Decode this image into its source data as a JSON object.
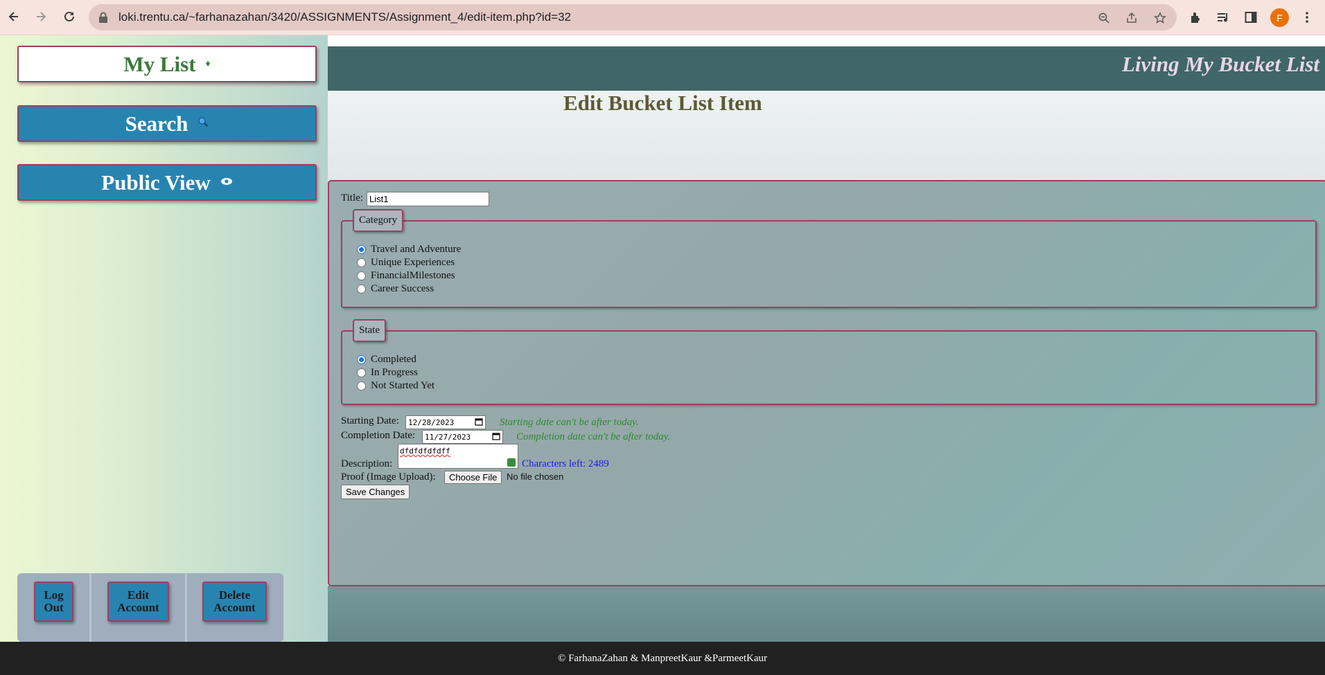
{
  "browser": {
    "url": "loki.trentu.ca/~farhanazahan/3420/ASSIGNMENTS/Assignment_4/edit-item.php?id=32",
    "profile_initial": "F",
    "icons": [
      "back-icon",
      "forward-icon",
      "reload-icon",
      "lock-icon",
      "zoom-icon",
      "share-icon",
      "star-icon",
      "extensions-icon",
      "media-icon",
      "side-panel-icon",
      "menu-icon"
    ]
  },
  "sidebar": {
    "mylist_label": "My List",
    "search_label": "Search",
    "public_label": "Public View",
    "logout_label": "Log Out",
    "edit_account_label": "Edit Account",
    "delete_account_label": "Delete Account"
  },
  "header": {
    "site_title": "Living My Bucket List",
    "page_title": "Edit Bucket List Item"
  },
  "form": {
    "title_label": "Title:",
    "title_value": "List1",
    "category_legend": "Category",
    "categories": [
      {
        "label": "Travel and Adventure",
        "checked": true
      },
      {
        "label": "Unique Experiences",
        "checked": false
      },
      {
        "label": "FinancialMilestones",
        "checked": false
      },
      {
        "label": "Career Success",
        "checked": false
      }
    ],
    "state_legend": "State",
    "states": [
      {
        "label": "Completed",
        "checked": true
      },
      {
        "label": "In Progress",
        "checked": false
      },
      {
        "label": "Not Started Yet",
        "checked": false
      }
    ],
    "start_label": "Starting Date:",
    "start_value": "12/28/2023",
    "start_hint": "Starting date can't be after today.",
    "end_label": "Completion Date:",
    "end_value": "11/27/2023",
    "end_hint": "Completion date can't be after today.",
    "desc_label": "Description:",
    "desc_value": "dfdfdfdfdff",
    "chars_left": "Characters left: 2489",
    "proof_label": "Proof (Image Upload):",
    "choose_file": "Choose File",
    "no_file": "No file chosen",
    "save_label": "Save Changes"
  },
  "footer": {
    "text": "© FarhanaZahan & ManpreetKaur &ParmeetKaur"
  },
  "colors": {
    "accent_blue": "#2784b0",
    "border_maroon": "#9c4061",
    "header_teal": "#3f6668",
    "hint_green": "#2d8a30"
  }
}
